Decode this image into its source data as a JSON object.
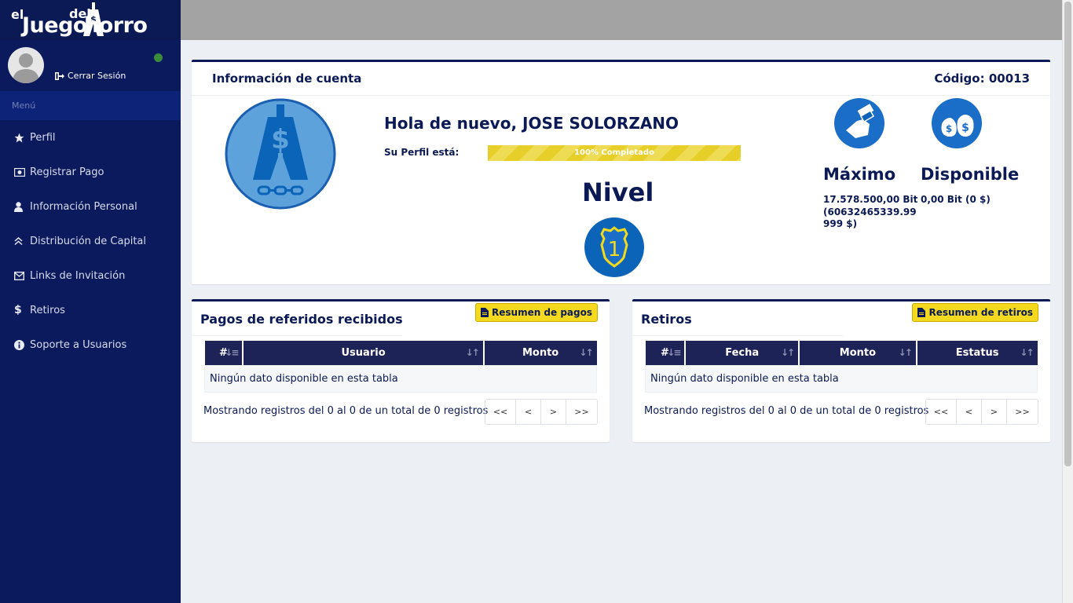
{
  "brand": {
    "el": "el",
    "juego": "Juego",
    "del": "del",
    "ahorro": "horro"
  },
  "user": {
    "logout_label": "Cerrar Sesión"
  },
  "sidebar": {
    "header": "Menú",
    "items": [
      {
        "label": "Perfil",
        "icon": "star-icon"
      },
      {
        "label": "Registrar Pago",
        "icon": "money-icon"
      },
      {
        "label": "Información Personal",
        "icon": "user-icon"
      },
      {
        "label": "Distribución de Capital",
        "icon": "chevron-up-icon"
      },
      {
        "label": "Links de Invitación",
        "icon": "envelope-icon"
      },
      {
        "label": "Retiros",
        "icon": "dollar-icon"
      },
      {
        "label": "Soporte a Usuarios",
        "icon": "info-icon"
      }
    ]
  },
  "account": {
    "title": "Información de cuenta",
    "code": "Código: 00013",
    "greeting": "Hola de nuevo, JOSE SOLORZANO",
    "profile_label": "Su Perfil está:",
    "progress_text": "100% Completado",
    "progress_percent": 100,
    "level_label": "Nivel",
    "level_value": "1",
    "max_title": "Máximo",
    "max_value": "17.578.500,00 Bit (60632465339.99999 $)",
    "available_title": "Disponible",
    "available_value": "0,00 Bit (0 $)"
  },
  "payments": {
    "title": "Pagos de referidos recibidos",
    "button": "Resumen de pagos",
    "columns": [
      "#",
      "Usuario",
      "Monto"
    ],
    "empty": "Ningún dato disponible en esta tabla",
    "info": "Mostrando registros del 0 al 0 de un total de 0 registros"
  },
  "withdrawals": {
    "title": "Retiros",
    "button": "Resumen de retiros",
    "columns": [
      "#",
      "Fecha",
      "Monto",
      "Estatus"
    ],
    "empty": "Ningún dato disponible en esta tabla",
    "info": "Mostrando registros del 0 al 0 de un total de 0 registros"
  },
  "pager": {
    "first": "<<",
    "prev": "<",
    "next": ">",
    "last": ">>"
  },
  "colors": {
    "navy": "#0b1a55",
    "sidebar": "#0a1a5c",
    "accent_yellow": "#f4d91f",
    "icon_blue": "#1a6ec8"
  }
}
